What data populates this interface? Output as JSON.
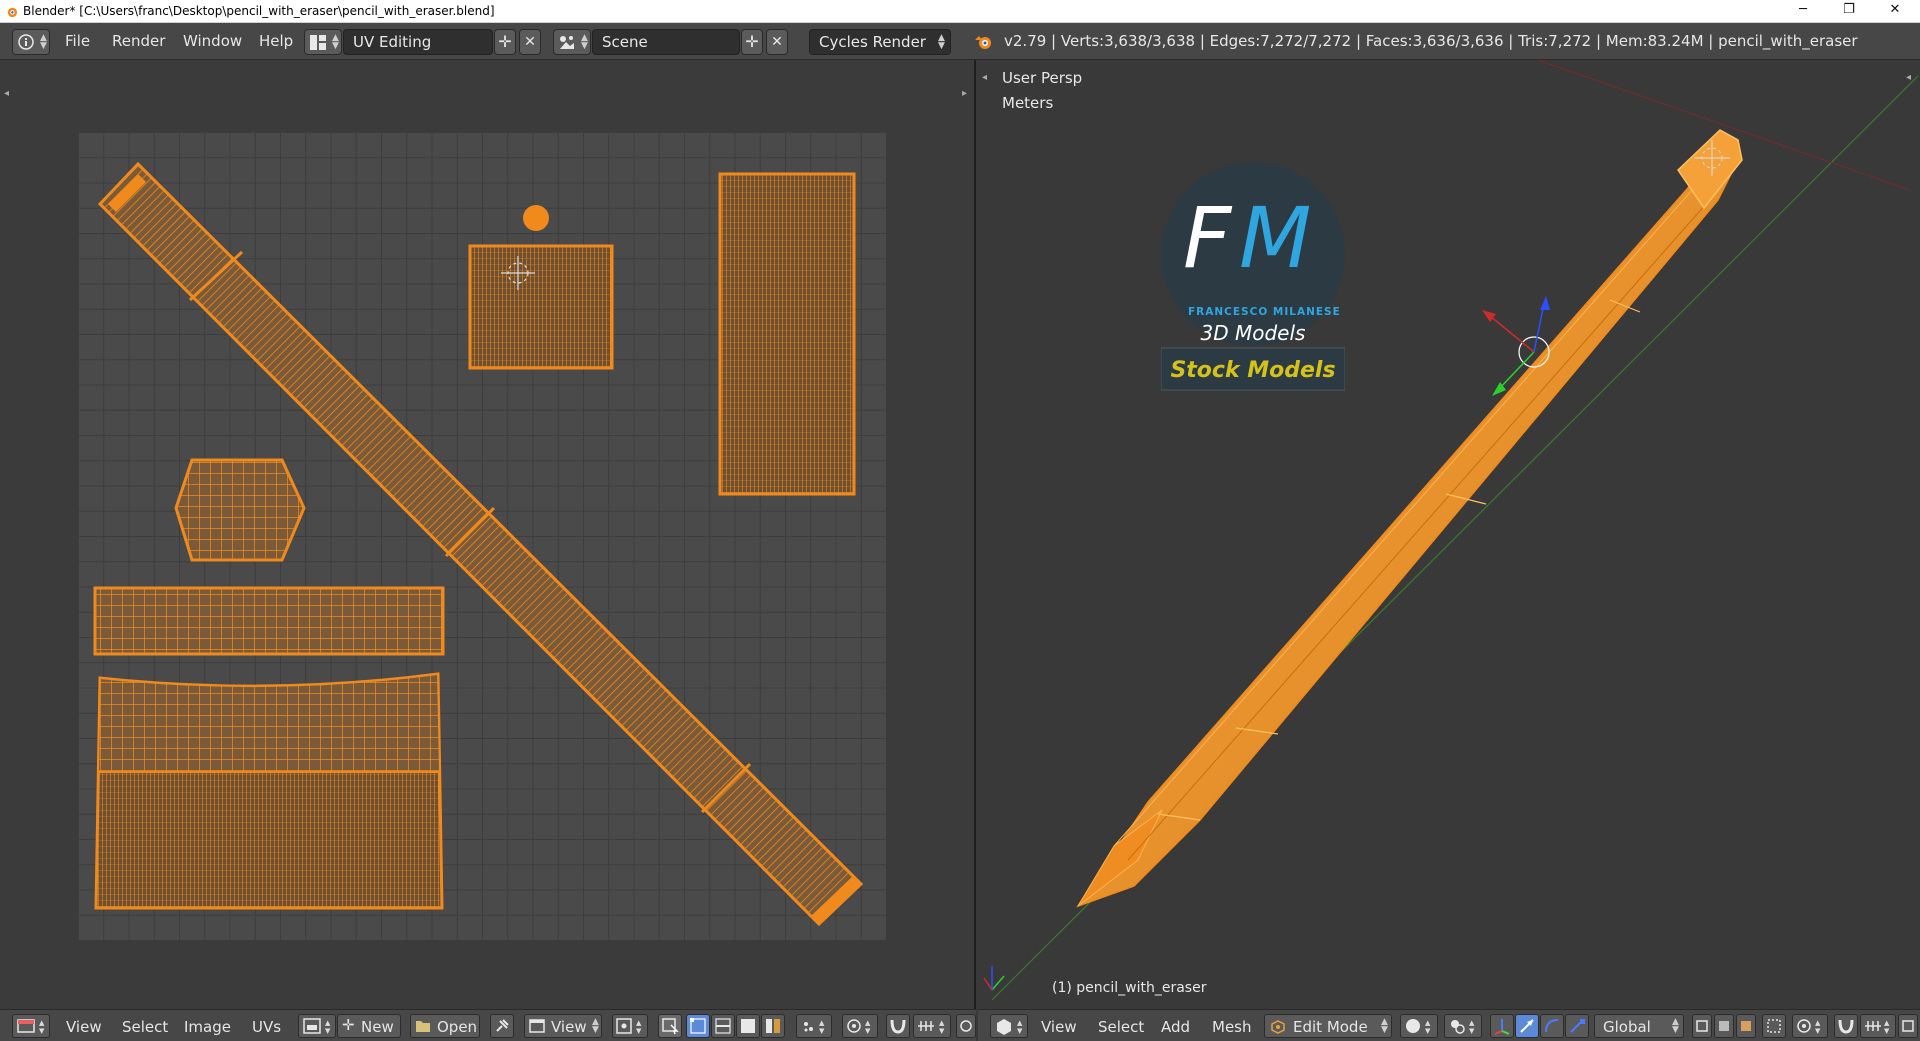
{
  "window": {
    "title": "Blender* [C:\\Users\\franc\\Desktop\\pencil_with_eraser\\pencil_with_eraser.blend]",
    "minimize_glyph": "─",
    "maximize_glyph": "❐",
    "close_glyph": "✕"
  },
  "info_header": {
    "menus": [
      "File",
      "Render",
      "Window",
      "Help"
    ],
    "screen_layout": "UV Editing",
    "scene": "Scene",
    "render_engine": "Cycles Render",
    "stats": "v2.79 | Verts:3,638/3,638 | Edges:7,272/7,272 | Faces:3,636/3,636 | Tris:7,272 | Mem:83.24M | pencil_with_eraser"
  },
  "uv_editor": {
    "footer_menus": [
      "View",
      "Select",
      "Image",
      "UVs"
    ],
    "new_label": "New",
    "open_label": "Open",
    "view_label": "View"
  },
  "viewport": {
    "view_name": "User Persp",
    "units": "Meters",
    "object_label": "(1) pencil_with_eraser",
    "footer_menus": [
      "View",
      "Select",
      "Add",
      "Mesh"
    ],
    "mode": "Edit Mode",
    "orientation": "Global"
  },
  "logo": {
    "letters_f": "F",
    "letters_m": "M",
    "name": "FRANCESCO MILANESE",
    "subtitle": "3D Models",
    "banner": "Stock Models"
  },
  "colors": {
    "accent_orange": "#f08a1c",
    "logo_blue": "#2fa6e0",
    "banner_yellow": "#d4c21a"
  }
}
